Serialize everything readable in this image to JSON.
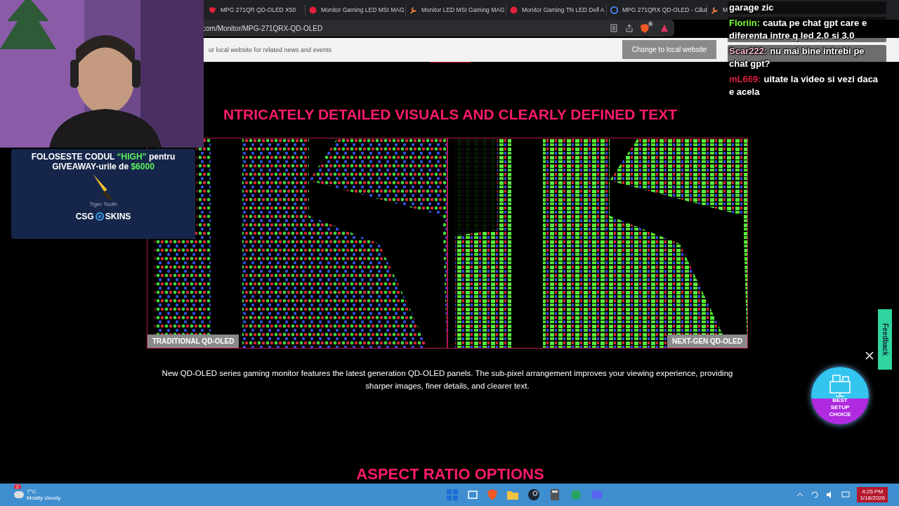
{
  "tabs": [
    {
      "title": "MPG 271QR QD-OLED X50"
    },
    {
      "title": "Monitor Gaming LED MSI MAG"
    },
    {
      "title": "Monitor LED MSI Gaming MAG"
    },
    {
      "title": "Monitor Gaming TN LED Dell A"
    },
    {
      "title": "MPG 271QRX QD-OLED - Căut"
    },
    {
      "title": "M"
    }
  ],
  "address_bar": {
    "url": "com/Monitor/MPG-271QRX-QD-OLED",
    "extension_badge": "4"
  },
  "banner": {
    "text": "ur local website for related news and events",
    "button": "Change to local website"
  },
  "section": {
    "heading": "NTRICATELY DETAILED VISUALS AND CLEARLY DEFINED TEXT",
    "images": [
      {
        "label": "TRADITIONAL QD-OLED",
        "kind": "round"
      },
      {
        "label": "NEXT-GEN QD-OLED",
        "kind": "square"
      }
    ],
    "caption": "New QD-OLED series gaming monitor features the latest generation QD-OLED panels. The sub-pixel arrangement improves your viewing experience, providing sharper images, finer details, and clearer text.",
    "next_heading": "ASPECT RATIO OPTIONS"
  },
  "feedback": "Feedback",
  "promo_badge": "BEST SETUP CHOICE",
  "ad": {
    "headline": [
      {
        "text": "FOLOSESTE CODUL ",
        "highlight": false
      },
      {
        "text": "“HIGH”",
        "highlight": true
      },
      {
        "text": " pentru GIVEAWAY-urile de ",
        "highlight": false
      },
      {
        "text": "$6000",
        "highlight": true
      }
    ],
    "item": "Tiger Tooth",
    "brand_left": "CSG",
    "brand_right": "SKINS"
  },
  "chat": [
    {
      "text": "garage zic"
    },
    {
      "user": "Floriin:",
      "color": "#7cfc3a",
      "text": "cauta pe chat gpt care e diferenta intre q led 2.0 si 3.0"
    },
    {
      "user": "Scar222:",
      "color": "#f4b8c8",
      "text": "nu mai bine intrebi pe chat gpt?"
    },
    {
      "user": "mL669:",
      "color": "#d81b3c",
      "text": "uitate la video si vezi daca e acela"
    }
  ],
  "taskbar": {
    "weather_badge": "2",
    "temperature": "7°C",
    "weather": "Mostly cloudy",
    "time": "4:25 PM",
    "date": "1/18/2026"
  }
}
